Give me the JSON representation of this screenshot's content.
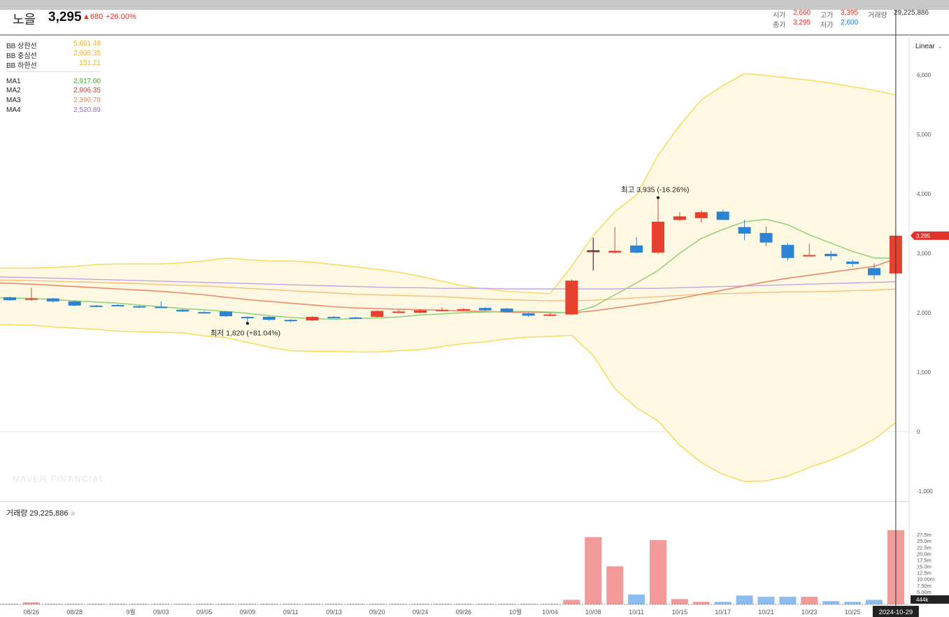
{
  "header": {
    "name": "노을",
    "price": "3,295",
    "change": "▲680",
    "change_pct": "+26.00%",
    "open_label": "시가",
    "open": "2,660",
    "high_label": "고가",
    "high": "3,395",
    "volume_label": "거래량",
    "volume": "29,225,886",
    "close_label": "종가",
    "close": "3,295",
    "low_label": "저가",
    "low": "2,600"
  },
  "legend": [
    {
      "label": "BB 상한선",
      "value": "5,661.49",
      "color": "#f0b429"
    },
    {
      "label": "BB 중심선",
      "value": "2,906.35",
      "color": "#f0b429"
    },
    {
      "label": "BB 하한선",
      "value": "151.21",
      "color": "#f0b429"
    },
    {
      "label": "MA1",
      "value": "2,917.00",
      "color": "#3fae2a"
    },
    {
      "label": "MA2",
      "value": "2,906.35",
      "color": "#e0352b"
    },
    {
      "label": "MA3",
      "value": "2,396.78",
      "color": "#f08a4b"
    },
    {
      "label": "MA4",
      "value": "2,520.89",
      "color": "#9b6bd6"
    }
  ],
  "scale_mode": "Linear",
  "watermark": "NAVER FINANCIAL",
  "volume_label": "거래량 29,225,886",
  "current_price_tag": "3,295",
  "current_volume_tag": "444k",
  "current_date_tag": "2024-10-29",
  "annotations": {
    "high": "최고 3,935 (-16.26%)",
    "low": "최저 1,820 (+81.04%)"
  },
  "colors": {
    "up": "#e8402f",
    "down": "#2b83d6",
    "up_vol": "#f19a99",
    "down_vol": "#8bbcf2",
    "band_fill": "#fff9e3",
    "band_line": "#f7db5e"
  },
  "chart_data": {
    "type": "candlestick",
    "ylim": [
      -1000,
      6000
    ],
    "yticks": [
      "6,000",
      "5,000",
      "4,000",
      "3,000",
      "2,000",
      "1,000",
      "0",
      "-1,000"
    ],
    "xticks": [
      "08/26",
      "08/28",
      "9월",
      "09/03",
      "09/05",
      "09/09",
      "09/11",
      "09/13",
      "09/20",
      "09/24",
      "09/26",
      "10월",
      "10/04",
      "10/08",
      "10/11",
      "10/15",
      "10/17",
      "10/21",
      "10/23",
      "10/25"
    ],
    "volume_ticks": [
      "27.5m",
      "25.0m",
      "22.5m",
      "20.0m",
      "17.5m",
      "15.0m",
      "12.5m",
      "10.00m",
      "7.50m",
      "5.00m"
    ],
    "candles": [
      {
        "o": 2260,
        "h": 2270,
        "l": 2200,
        "c": 2210,
        "v": 0.2
      },
      {
        "o": 2220,
        "h": 2420,
        "l": 2200,
        "c": 2240,
        "v": 0.8
      },
      {
        "o": 2240,
        "h": 2250,
        "l": 2170,
        "c": 2190,
        "v": 0.2
      },
      {
        "o": 2190,
        "h": 2200,
        "l": 2110,
        "c": 2120,
        "v": 0.2
      },
      {
        "o": 2120,
        "h": 2130,
        "l": 2090,
        "c": 2100,
        "v": 0.1
      },
      {
        "o": 2130,
        "h": 2140,
        "l": 2110,
        "c": 2120,
        "v": 0.1
      },
      {
        "o": 2110,
        "h": 2120,
        "l": 2080,
        "c": 2090,
        "v": 0.1
      },
      {
        "o": 2100,
        "h": 2190,
        "l": 2080,
        "c": 2090,
        "v": 0.1
      },
      {
        "o": 2050,
        "h": 2060,
        "l": 2010,
        "c": 2020,
        "v": 0.1
      },
      {
        "o": 2010,
        "h": 2030,
        "l": 1990,
        "c": 2000,
        "v": 0.1
      },
      {
        "o": 2020,
        "h": 2030,
        "l": 1930,
        "c": 1940,
        "v": 0.1
      },
      {
        "o": 1930,
        "h": 1940,
        "l": 1820,
        "c": 1920,
        "v": 0.1
      },
      {
        "o": 1930,
        "h": 1940,
        "l": 1860,
        "c": 1880,
        "v": 0.1
      },
      {
        "o": 1880,
        "h": 1890,
        "l": 1840,
        "c": 1860,
        "v": 0.1
      },
      {
        "o": 1870,
        "h": 1940,
        "l": 1860,
        "c": 1930,
        "v": 0.1
      },
      {
        "o": 1930,
        "h": 1940,
        "l": 1910,
        "c": 1920,
        "v": 0.1
      },
      {
        "o": 1920,
        "h": 1930,
        "l": 1900,
        "c": 1910,
        "v": 0.1
      },
      {
        "o": 1930,
        "h": 2040,
        "l": 1920,
        "c": 2030,
        "v": 0.1
      },
      {
        "o": 2000,
        "h": 2050,
        "l": 1990,
        "c": 2020,
        "v": 0.1
      },
      {
        "o": 2000,
        "h": 2060,
        "l": 1990,
        "c": 2040,
        "v": 0.1
      },
      {
        "o": 2030,
        "h": 2090,
        "l": 2020,
        "c": 2050,
        "v": 0.1
      },
      {
        "o": 2040,
        "h": 2080,
        "l": 2020,
        "c": 2060,
        "v": 0.1
      },
      {
        "o": 2080,
        "h": 2090,
        "l": 2030,
        "c": 2040,
        "v": 0.1
      },
      {
        "o": 2070,
        "h": 2080,
        "l": 2000,
        "c": 2010,
        "v": 0.1
      },
      {
        "o": 1990,
        "h": 2000,
        "l": 1930,
        "c": 1950,
        "v": 0.1
      },
      {
        "o": 1950,
        "h": 1990,
        "l": 1940,
        "c": 1970,
        "v": 0.1
      },
      {
        "o": 1970,
        "h": 2560,
        "l": 1960,
        "c": 2540,
        "v": 1.8
      },
      {
        "o": 3040,
        "h": 3260,
        "l": 2710,
        "c": 3040,
        "v": 26.5
      },
      {
        "o": 3010,
        "h": 3440,
        "l": 3000,
        "c": 3040,
        "v": 15.0
      },
      {
        "o": 3130,
        "h": 3270,
        "l": 3000,
        "c": 3010,
        "v": 3.9
      },
      {
        "o": 3010,
        "h": 3935,
        "l": 2990,
        "c": 3530,
        "v": 25.3
      },
      {
        "o": 3560,
        "h": 3690,
        "l": 3540,
        "c": 3620,
        "v": 2.1
      },
      {
        "o": 3590,
        "h": 3720,
        "l": 3520,
        "c": 3690,
        "v": 1.0
      },
      {
        "o": 3700,
        "h": 3730,
        "l": 3560,
        "c": 3560,
        "v": 1.0
      },
      {
        "o": 3440,
        "h": 3560,
        "l": 3220,
        "c": 3330,
        "v": 3.5
      },
      {
        "o": 3340,
        "h": 3450,
        "l": 3120,
        "c": 3180,
        "v": 3.0
      },
      {
        "o": 3140,
        "h": 3170,
        "l": 2880,
        "c": 2920,
        "v": 3.0
      },
      {
        "o": 2960,
        "h": 3160,
        "l": 2950,
        "c": 2970,
        "v": 3.0
      },
      {
        "o": 2990,
        "h": 3040,
        "l": 2880,
        "c": 2950,
        "v": 1.3
      },
      {
        "o": 2860,
        "h": 2890,
        "l": 2770,
        "c": 2820,
        "v": 1.0
      },
      {
        "o": 2750,
        "h": 2830,
        "l": 2560,
        "c": 2630,
        "v": 1.8
      },
      {
        "o": 2660,
        "h": 3395,
        "l": 2600,
        "c": 3295,
        "v": 29.2
      }
    ],
    "bb_upper": [
      2750,
      2750,
      2760,
      2780,
      2810,
      2820,
      2820,
      2820,
      2840,
      2870,
      2920,
      2890,
      2870,
      2870,
      2850,
      2810,
      2770,
      2730,
      2680,
      2610,
      2530,
      2450,
      2400,
      2360,
      2340,
      2320,
      2780,
      3300,
      3700,
      3980,
      4650,
      5150,
      5580,
      5820,
      6020,
      5990,
      5950,
      5910,
      5860,
      5800,
      5740,
      5661
    ],
    "bb_lower": [
      1800,
      1790,
      1760,
      1740,
      1720,
      1690,
      1680,
      1670,
      1660,
      1610,
      1580,
      1500,
      1420,
      1360,
      1350,
      1350,
      1340,
      1340,
      1360,
      1380,
      1430,
      1480,
      1510,
      1560,
      1590,
      1600,
      1620,
      1280,
      720,
      400,
      180,
      -230,
      -520,
      -720,
      -840,
      -830,
      -750,
      -600,
      -480,
      -320,
      -130,
      151
    ],
    "bb_mid": [
      2280,
      2280,
      2270,
      2260,
      2260,
      2250,
      2250,
      2245,
      2240,
      2240,
      2250,
      2195,
      2145,
      2095,
      2085,
      2085,
      2080,
      2075,
      2070,
      2060,
      2060,
      2060,
      2060,
      2060,
      2060,
      2060,
      2200,
      2290,
      2210,
      2190,
      2210,
      2250,
      2300,
      2330,
      2350,
      2370,
      2390,
      2390,
      2400,
      2410,
      2420,
      2906
    ],
    "ma1": [
      2250,
      2240,
      2220,
      2200,
      2180,
      2160,
      2130,
      2100,
      2070,
      2050,
      2020,
      1990,
      1950,
      1920,
      1900,
      1890,
      1900,
      1910,
      1930,
      1960,
      1980,
      2000,
      2010,
      2020,
      2020,
      2010,
      2000,
      2100,
      2300,
      2500,
      2710,
      3000,
      3250,
      3400,
      3530,
      3570,
      3480,
      3310,
      3170,
      3030,
      2920,
      2917
    ],
    "ma2": [
      2500,
      2480,
      2460,
      2440,
      2420,
      2400,
      2380,
      2360,
      2330,
      2300,
      2260,
      2220,
      2190,
      2160,
      2130,
      2100,
      2080,
      2070,
      2060,
      2050,
      2040,
      2030,
      2020,
      2010,
      2010,
      2000,
      2000,
      2030,
      2080,
      2130,
      2180,
      2240,
      2310,
      2380,
      2450,
      2520,
      2580,
      2630,
      2680,
      2730,
      2780,
      2906
    ],
    "ma3": [
      2550,
      2540,
      2530,
      2520,
      2510,
      2500,
      2490,
      2470,
      2460,
      2450,
      2430,
      2410,
      2390,
      2370,
      2350,
      2330,
      2310,
      2300,
      2290,
      2280,
      2270,
      2250,
      2230,
      2220,
      2210,
      2200,
      2200,
      2210,
      2230,
      2250,
      2270,
      2290,
      2310,
      2320,
      2330,
      2340,
      2350,
      2350,
      2360,
      2370,
      2380,
      2397
    ],
    "ma4": [
      2600,
      2590,
      2580,
      2570,
      2560,
      2550,
      2540,
      2530,
      2520,
      2510,
      2500,
      2490,
      2480,
      2470,
      2460,
      2450,
      2440,
      2430,
      2420,
      2420,
      2410,
      2410,
      2410,
      2400,
      2400,
      2400,
      2400,
      2400,
      2400,
      2410,
      2410,
      2420,
      2430,
      2440,
      2450,
      2460,
      2470,
      2480,
      2490,
      2500,
      2510,
      2521
    ]
  }
}
